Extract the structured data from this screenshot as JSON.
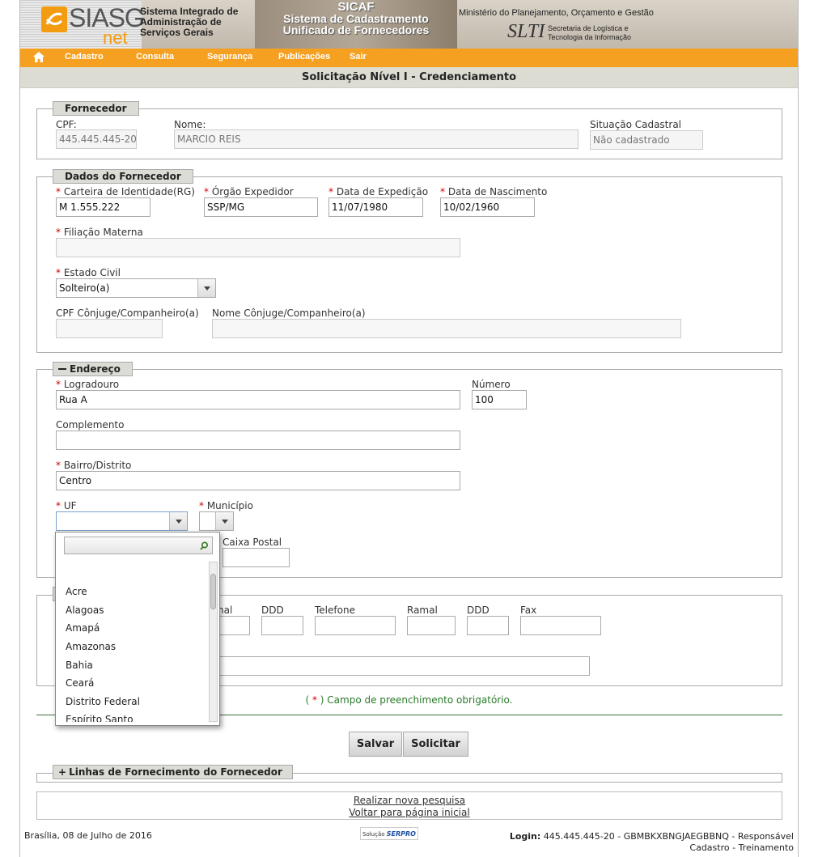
{
  "header": {
    "logo": "SIASG",
    "logo_sub": "net",
    "system_name_1": "Sistema Integrado de",
    "system_name_2": "Administração de",
    "system_name_3": "Serviços Gerais",
    "sicaf": "SICAF",
    "sicaf_line1": "Sistema de Cadastramento",
    "sicaf_line2": "Unificado de Fornecedores",
    "ministerio": "Ministério do Planejamento, Orçamento e Gestão",
    "slti": "SLTI",
    "slti_sub1": "Secretaria de Logística e",
    "slti_sub2": "Tecnologia da Informação"
  },
  "nav": {
    "items": [
      "Cadastro",
      "Consulta",
      "Segurança",
      "Publicações",
      "Sair"
    ]
  },
  "page_title": "Solicitação Nível I - Credenciamento",
  "fornecedor": {
    "legend": "Fornecedor",
    "cpf_label": "CPF:",
    "cpf_value": "445.445.445-20",
    "nome_label": "Nome:",
    "nome_value": "MARCIO REIS",
    "situacao_label": "Situação Cadastral",
    "situacao_value": "Não cadastrado"
  },
  "dados": {
    "legend": "Dados do Fornecedor",
    "rg_label": "Carteira de Identidade(RG)",
    "rg_value": "M 1.555.222",
    "orgao_label": "Órgão Expedidor",
    "orgao_value": "SSP/MG",
    "data_exp_label": "Data de Expedição",
    "data_exp_value": "11/07/1980",
    "data_nasc_label": "Data de Nascimento",
    "data_nasc_value": "10/02/1960",
    "filiacao_label": "Filiação Materna",
    "estado_civil_label": "Estado Civil",
    "estado_civil_value": "Solteiro(a)",
    "cpf_conjuge_label": "CPF Cônjuge/Companheiro(a)",
    "nome_conjuge_label": "Nome Cônjuge/Companheiro(a)"
  },
  "endereco": {
    "legend": "Endereço",
    "logradouro_label": "Logradouro",
    "logradouro_value": "Rua A",
    "numero_label": "Número",
    "numero_value": "100",
    "complemento_label": "Complemento",
    "bairro_label": "Bairro/Distrito",
    "bairro_value": "Centro",
    "uf_label": "UF",
    "municipio_label": "Município",
    "caixa_postal_label": "Caixa Postal"
  },
  "contato": {
    "ramal1_label": "nal",
    "ddd1_label": "DDD",
    "telefone_label": "Telefone",
    "ramal2_label": "Ramal",
    "ddd2_label": "DDD",
    "fax_label": "Fax"
  },
  "uf_dropdown": {
    "options": [
      "Acre",
      "Alagoas",
      "Amapá",
      "Amazonas",
      "Bahia",
      "Ceará",
      "Distrito Federal",
      "Espírito Santo"
    ]
  },
  "required_mark": "*",
  "note_prefix": "( ",
  "note_mark": "*",
  "note_suffix": " ) Campo de preenchimento obrigatório.",
  "buttons": {
    "salvar": "Salvar",
    "solicitar": "Solicitar"
  },
  "linhas": {
    "legend": "Linhas de Fornecimento do Fornecedor"
  },
  "links": {
    "nova_pesquisa": "Realizar nova pesquisa",
    "voltar": "Voltar para página inicial"
  },
  "footer": {
    "date": "Brasília, 08 de Julho de 2016",
    "solucao": "Solução",
    "serpro": "SERPRO",
    "login_label": "Login:",
    "login_value": " 445.445.445-20 - GBMBKXBNGJAEGBBNQ - Responsável",
    "login_line2": "Cadastro - Treinamento"
  },
  "colors": {
    "nav": "#f5a020",
    "legend_bg": "#dcdcd6",
    "required": "#cc0000",
    "note": "#2a7a2a"
  }
}
